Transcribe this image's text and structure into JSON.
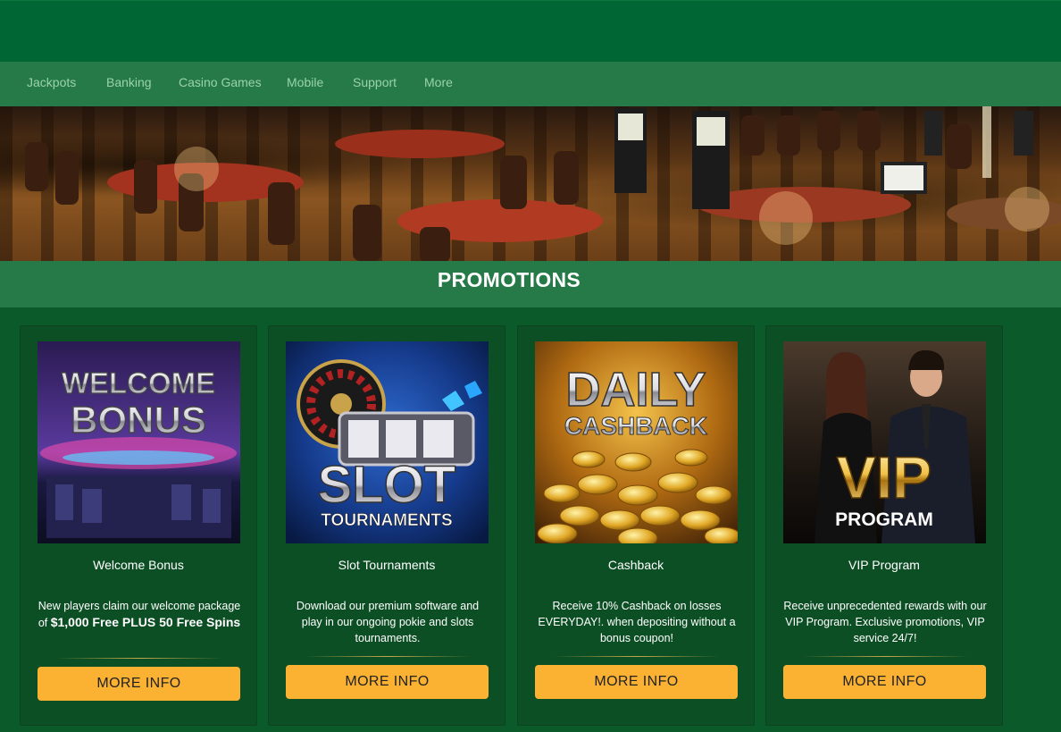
{
  "nav": {
    "items": [
      {
        "label": "Jackpots"
      },
      {
        "label": "Banking"
      },
      {
        "label": "Casino Games"
      },
      {
        "label": "Mobile"
      },
      {
        "label": "Support"
      },
      {
        "label": "More"
      }
    ]
  },
  "promotions": {
    "heading": "PROMOTIONS",
    "cards": [
      {
        "image_line1": "WELCOME",
        "image_line2": "BONUS",
        "title": "Welcome Bonus",
        "desc_pre": "New players claim our welcome package of ",
        "desc_bold": "$1,000 Free PLUS 50 Free Spins",
        "button": "MORE INFO"
      },
      {
        "image_line1": "SLOT",
        "image_line2": "TOURNAMENTS",
        "title": "Slot Tournaments",
        "desc": "Download our premium software and play in our ongoing pokie and slots tournaments.",
        "button": "MORE INFO"
      },
      {
        "image_line1": "DAILY",
        "image_line2": "CASHBACK",
        "title": "Cashback",
        "desc": "Receive 10% Cashback on losses EVERYDAY!. when depositing without a bonus coupon!",
        "button": "MORE INFO"
      },
      {
        "image_line1": "VIP",
        "image_line2": "PROGRAM",
        "title": "VIP Program",
        "desc": "Receive unprecedented rewards with our VIP Program. Exclusive promotions, VIP service 24/7!",
        "button": "MORE INFO"
      }
    ]
  },
  "colors": {
    "top_bar": "#006633",
    "nav_bar": "#267a47",
    "nav_text": "#9ad3a8",
    "page_bg": "#0b5a2a",
    "card_bg": "#0d4f25",
    "button": "#fbb233"
  }
}
